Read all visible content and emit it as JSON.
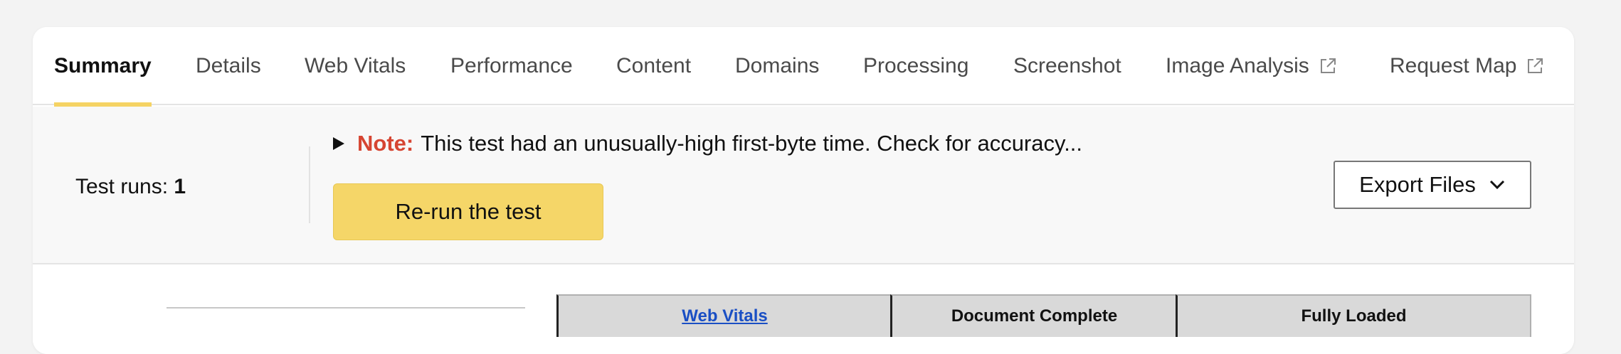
{
  "tabs": [
    {
      "label": "Summary",
      "active": true
    },
    {
      "label": "Details"
    },
    {
      "label": "Web Vitals"
    },
    {
      "label": "Performance"
    },
    {
      "label": "Content"
    },
    {
      "label": "Domains"
    },
    {
      "label": "Processing"
    },
    {
      "label": "Screenshot"
    },
    {
      "label": "Image Analysis",
      "icon": "external-link-icon"
    },
    {
      "label": "Request Map",
      "icon": "external-link-icon"
    }
  ],
  "info": {
    "test_runs_label": "Test runs:",
    "test_runs_value": "1",
    "note_label": "Note:",
    "note_text": "This test had an unusually-high first-byte time. Check for accuracy...",
    "rerun_label": "Re-run the test",
    "export_label": "Export Files"
  },
  "table": {
    "headers": [
      "Web Vitals",
      "Document Complete",
      "Fully Loaded"
    ]
  },
  "colors": {
    "accent": "#f5d364",
    "note_red": "#d64532",
    "link_blue": "#1a4fc4"
  }
}
